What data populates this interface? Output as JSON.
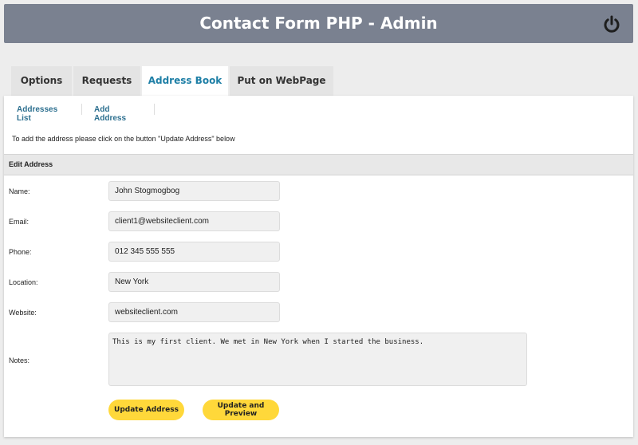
{
  "header": {
    "title": "Contact Form PHP - Admin"
  },
  "tabs": [
    {
      "label": "Options"
    },
    {
      "label": "Requests"
    },
    {
      "label": "Address Book"
    },
    {
      "label": "Put on WebPage"
    }
  ],
  "subnav": {
    "list_label": "Addresses List",
    "add_label": "Add Address"
  },
  "info_text": "To add the address please click on the button \"Update Address\" below",
  "section_title": "Edit Address",
  "form": {
    "name_label": "Name:",
    "name_value": "John Stogmogbog",
    "email_label": "Email:",
    "email_value": "client1@websiteclient.com",
    "phone_label": "Phone:",
    "phone_value": "012 345 555 555",
    "location_label": "Location:",
    "location_value": "New York",
    "website_label": "Website:",
    "website_value": "websiteclient.com",
    "notes_label": "Notes:",
    "notes_value": "This is my first client. We met in New York when I started the business."
  },
  "buttons": {
    "update_label": "Update Address",
    "preview_label": "Update and Preview"
  },
  "colors": {
    "header_bg": "#7a8190",
    "accent_link": "#1e7fa6",
    "button_yellow": "#ffd83a"
  }
}
